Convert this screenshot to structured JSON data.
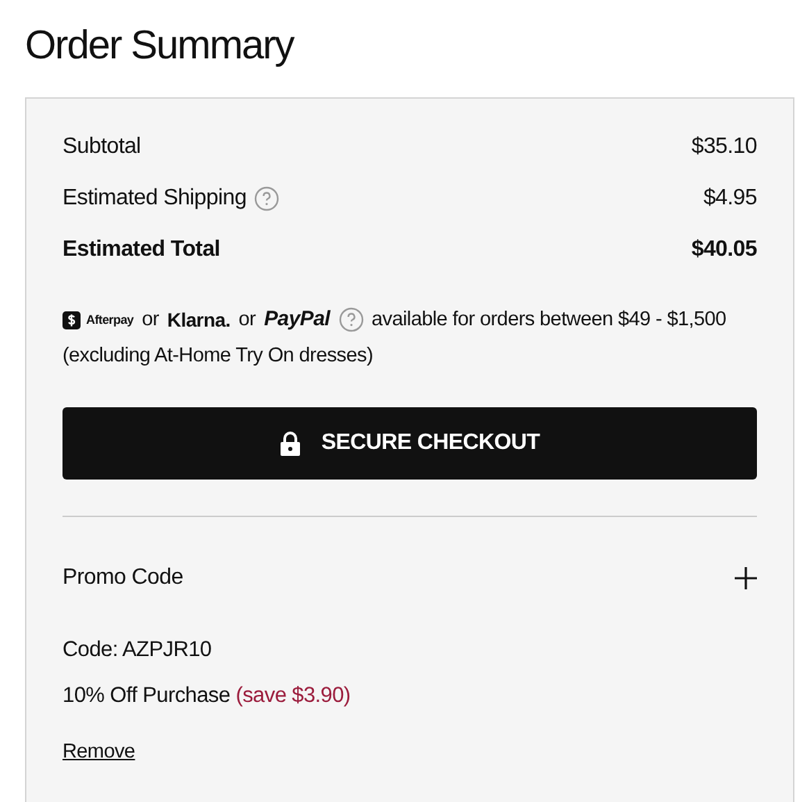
{
  "title": "Order Summary",
  "lines": [
    {
      "label": "Subtotal",
      "value": "$35.10",
      "bold": false,
      "help": false
    },
    {
      "label": "Estimated Shipping",
      "value": "$4.95",
      "bold": false,
      "help": true
    },
    {
      "label": "Estimated Total",
      "value": "$40.05",
      "bold": true,
      "help": false
    }
  ],
  "payment_note": {
    "providers": [
      {
        "kind": "afterpay",
        "name": "Afterpay"
      },
      {
        "kind": "klarna",
        "name": "Klarna.",
        "prefix": "or"
      },
      {
        "kind": "paypal",
        "name": "PayPal",
        "prefix": "or"
      }
    ],
    "text": "available for orders between $49 - $1,500",
    "note": "(excluding At-Home Try On dresses)"
  },
  "checkout_button": "SECURE CHECKOUT",
  "promo": {
    "label": "Promo Code",
    "expanded": false,
    "code": "Code: AZPJR10",
    "discount": "10% Off Purchase",
    "savings": "(save $3.90)",
    "remove": "Remove"
  }
}
